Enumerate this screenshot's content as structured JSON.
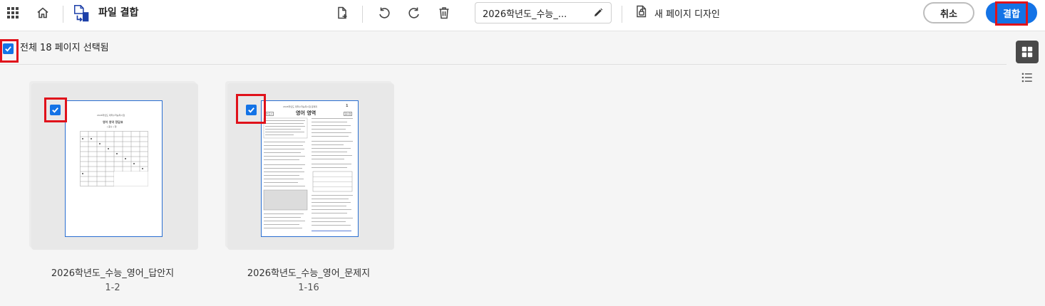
{
  "app": {
    "title": "파일 결합"
  },
  "toolbar": {
    "filename": "2026학년도_수능_...",
    "new_page_design": "새 페이지 디자인",
    "cancel_label": "취소",
    "combine_label": "결합"
  },
  "selection": {
    "label": "전체 18 페이지 선택됨",
    "all_checked": true
  },
  "files": [
    {
      "name": "2026학년도_수능_영어_답안지",
      "range": "1-2",
      "checked": true,
      "preview": {
        "header1": "2026학년도 대학수학능력시험",
        "header2": "영어 영역 정답표",
        "header3": "( 홀수 ) 형"
      }
    },
    {
      "name": "2026학년도_수능_영어_문제지",
      "range": "1-16",
      "checked": true,
      "preview": {
        "header1": "2026학년도 대학수학능력시험 문제지",
        "header2": "영어 영역",
        "page_no": "1",
        "tag_left": "제3교시",
        "tag_right": "홀수형"
      }
    }
  ],
  "colors": {
    "accent": "#1473e6",
    "highlight": "#e0121b"
  },
  "icons": {
    "apps": "apps-grid-icon",
    "home": "home-icon",
    "combine": "combine-files-icon",
    "add_file": "add-file-icon",
    "undo": "undo-icon",
    "redo": "redo-icon",
    "delete": "trash-icon",
    "edit": "pencil-icon",
    "page_design": "page-design-icon",
    "grid_view": "grid-view-icon",
    "list_view": "list-view-icon"
  }
}
